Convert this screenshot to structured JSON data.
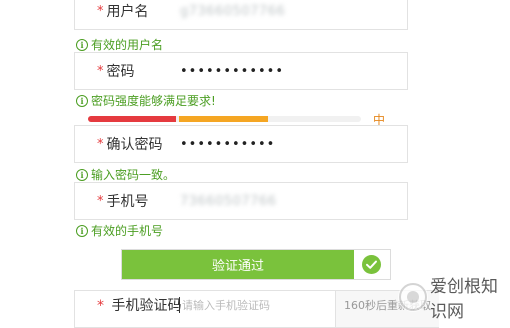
{
  "username_field": {
    "label": "用户名",
    "value": "g73660507766"
  },
  "username_tip": "有效的用户名",
  "password_field": {
    "label": "密码",
    "value": "••••••••••••"
  },
  "password_tip": "密码强度能够满足要求!",
  "password_strength": {
    "level": 2,
    "max": 3,
    "label": "中"
  },
  "confirm_field": {
    "label": "确认密码",
    "value": "•••••••••••"
  },
  "confirm_tip": "输入密码一致。",
  "phone_field": {
    "label": "手机号",
    "value": "73660507766"
  },
  "phone_tip": "有效的手机号",
  "verify": {
    "label": "验证通过"
  },
  "sms_field": {
    "label": "手机验证码",
    "placeholder": "请输入手机验证码",
    "button": "160秒后重新获取"
  },
  "watermark": {
    "text": "爱创根知识网"
  },
  "colors": {
    "success_green": "#4b9e22",
    "verify_green": "#7ac23c",
    "required_red": "#e4393c",
    "strength_weak": "#e53a3f",
    "strength_medium": "#f5a623"
  }
}
